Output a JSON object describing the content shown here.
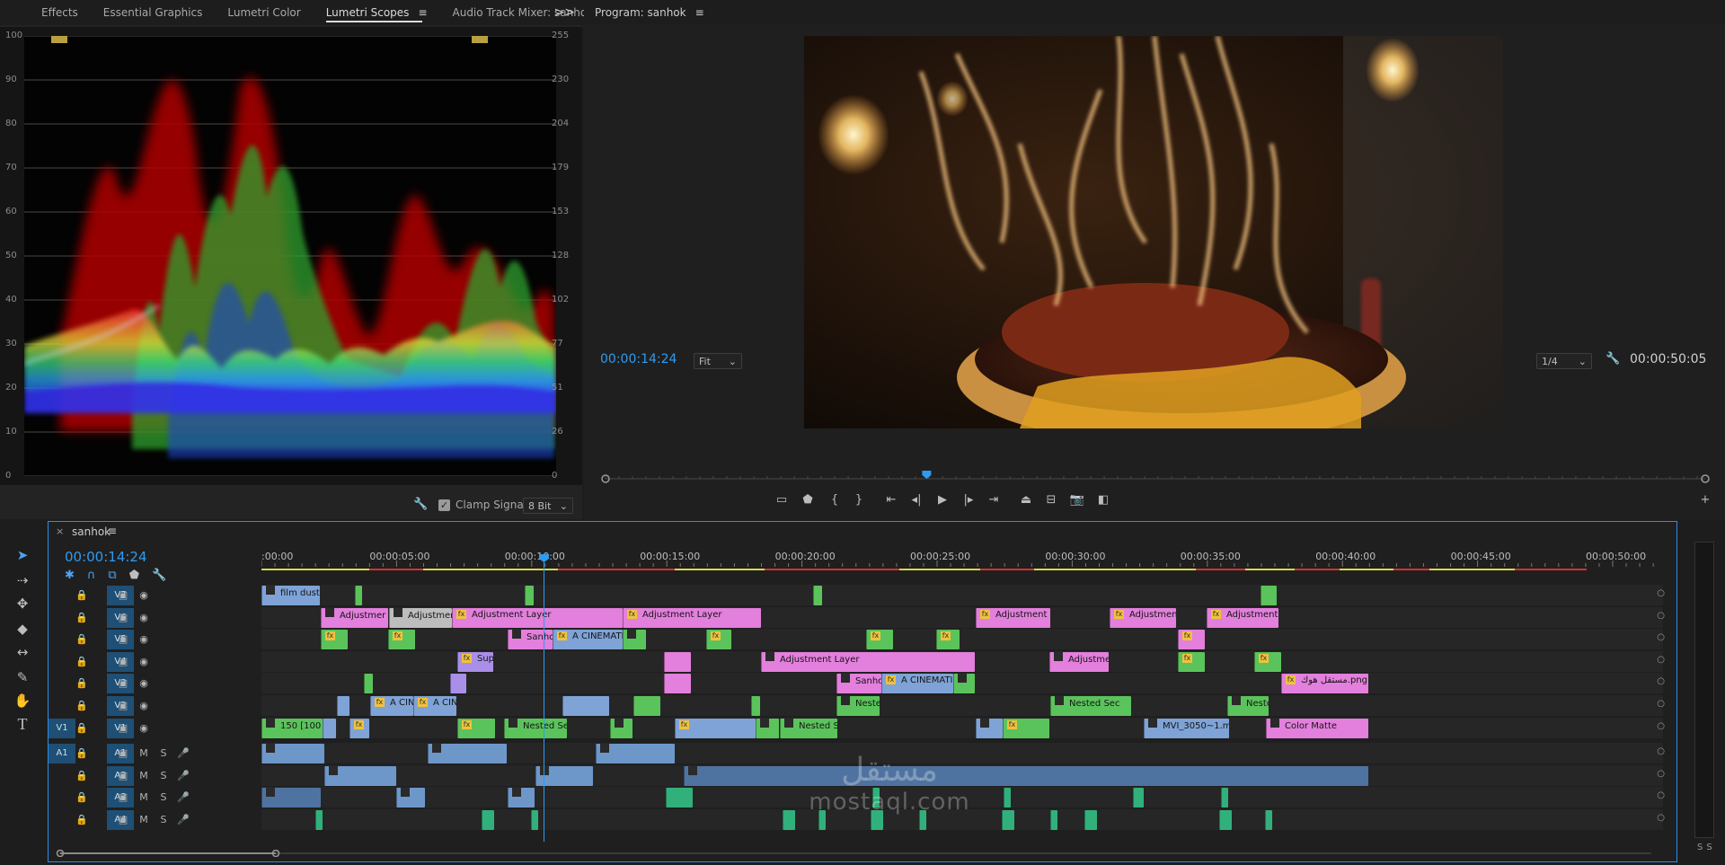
{
  "scopes_panel": {
    "tabs": [
      "Effects",
      "Essential Graphics",
      "Lumetri Color",
      "Lumetri Scopes",
      "Audio Track Mixer: sanho"
    ],
    "active_tab": "Lumetri Scopes",
    "left_scale": [
      "100",
      "90",
      "80",
      "70",
      "60",
      "50",
      "40",
      "30",
      "20",
      "10",
      "0"
    ],
    "right_scale": [
      "255",
      "230",
      "204",
      "179",
      "153",
      "128",
      "102",
      "77",
      "51",
      "26",
      "0"
    ],
    "clamp_label": "Clamp Signal",
    "clamp_checked": true,
    "bit_depth": "8 Bit",
    "overflow_icon": ">>"
  },
  "program_panel": {
    "title": "Program: sanhok",
    "current_timecode": "00:00:14:24",
    "zoom": "Fit",
    "resolution": "1/4",
    "duration": "00:00:50:05",
    "playhead_fraction": 0.292
  },
  "timeline": {
    "sequence_name": "sanhok",
    "timecode": "00:00:14:24",
    "ruler": [
      ":00:00",
      "00:00:05:00",
      "00:00:10:00",
      "00:00:15:00",
      "00:00:20:00",
      "00:00:25:00",
      "00:00:30:00",
      "00:00:35:00",
      "00:00:40:00",
      "00:00:45:00",
      "00:00:50:00"
    ],
    "video_tracks": [
      {
        "name": "V7",
        "source": ""
      },
      {
        "name": "V6",
        "source": ""
      },
      {
        "name": "V5",
        "source": ""
      },
      {
        "name": "V4",
        "source": ""
      },
      {
        "name": "V3",
        "source": ""
      },
      {
        "name": "V2",
        "source": ""
      },
      {
        "name": "V1",
        "source": "V1"
      }
    ],
    "audio_tracks": [
      {
        "name": "A1",
        "source": "A1",
        "m": "M",
        "s": "S"
      },
      {
        "name": "A2",
        "source": "",
        "m": "M",
        "s": "S"
      },
      {
        "name": "A3",
        "source": "",
        "m": "M",
        "s": "S"
      },
      {
        "name": "A4",
        "source": "",
        "m": "M",
        "s": "S"
      }
    ],
    "clips": {
      "v7_1": "film dust fx.ef",
      "v6_1": "Adjustmer",
      "v6_2": "Adjustment La",
      "v6_3": "Adjustment Layer",
      "v6_4": "Adjustment Layer",
      "v6_5": "Adjustment Layer",
      "v6_6": "Adjustment Lay",
      "v6_7": "Adjustment La",
      "v5_1": "Sanhok",
      "v5_2": "A CINEMATIC B",
      "v4_1": "Super",
      "v4_2": "Adjustment Layer",
      "v4_3": "Adjustment",
      "v3_1": "Sanhok",
      "v3_2": "A CINEMATIC B",
      "v3_3": "مستقل هوك.png",
      "v2_1": "A CINE",
      "v2_2": "A CINE",
      "v2_3": "Nested",
      "v2_4": "Nested Sec",
      "v2_5": "Nested",
      "v1_1": "150 [100",
      "v1_2": "Nested Sequer",
      "v1_3": "Nested Seq",
      "v1_4": "MVI_3050~1.mp4",
      "v1_5": "Color Matte"
    }
  },
  "meters": {
    "labels": [
      "S",
      "S"
    ]
  },
  "watermark": {
    "arabic": "مستقل",
    "latin": "mostaql.com"
  },
  "colors": {
    "accent": "#2f9bf0",
    "adjustment": "#e37fdc",
    "video": "#7fa3d6",
    "nested": "#5bc35b",
    "graphic": "#a98fe8",
    "audio": "#6d97c9"
  }
}
